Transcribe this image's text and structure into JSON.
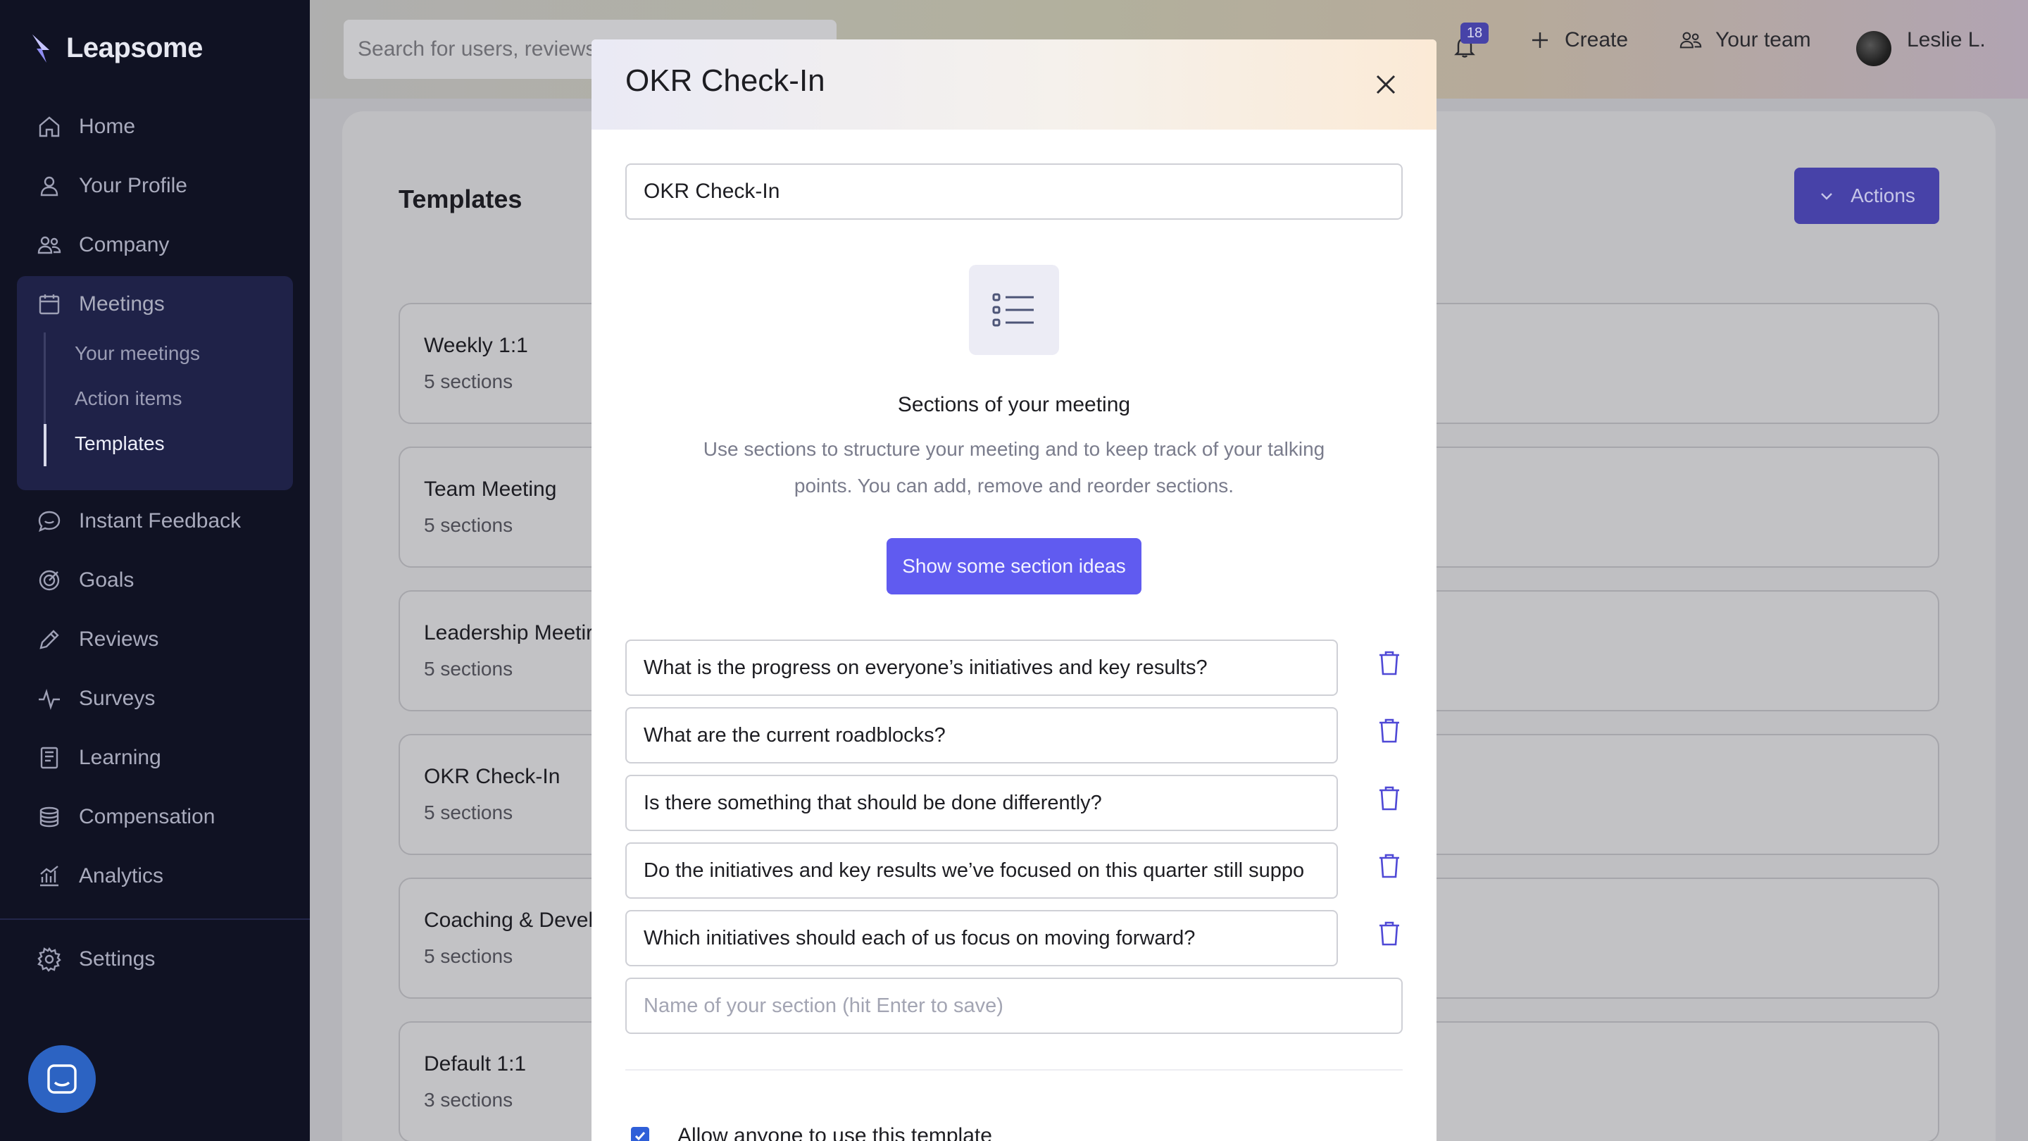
{
  "brand": {
    "name": "Leapsome"
  },
  "sidebar": {
    "items": [
      {
        "label": "Home",
        "icon": "home-icon"
      },
      {
        "label": "Your Profile",
        "icon": "user-icon"
      },
      {
        "label": "Company",
        "icon": "users-icon"
      },
      {
        "label": "Meetings",
        "icon": "calendar-icon"
      },
      {
        "label": "Instant Feedback",
        "icon": "chat-icon"
      },
      {
        "label": "Goals",
        "icon": "target-icon"
      },
      {
        "label": "Reviews",
        "icon": "pencil-icon"
      },
      {
        "label": "Surveys",
        "icon": "pulse-icon"
      },
      {
        "label": "Learning",
        "icon": "book-icon"
      },
      {
        "label": "Compensation",
        "icon": "coins-icon"
      },
      {
        "label": "Analytics",
        "icon": "chart-icon"
      },
      {
        "label": "Settings",
        "icon": "gear-icon"
      }
    ],
    "meetings_sub": [
      {
        "label": "Your meetings"
      },
      {
        "label": "Action items"
      },
      {
        "label": "Templates",
        "active": true
      }
    ]
  },
  "header": {
    "search_placeholder": "Search for users, reviews",
    "notification_count": "18",
    "create_label": "Create",
    "team_label": "Your team",
    "user_name": "Leslie L."
  },
  "main": {
    "title": "Templates",
    "actions_label": "Actions",
    "templates": [
      {
        "name": "Weekly 1:1",
        "sections": "5 sections"
      },
      {
        "name": "Team Meeting",
        "sections": "5 sections"
      },
      {
        "name": "Leadership Meetir",
        "sections": "5 sections"
      },
      {
        "name": "OKR Check-In",
        "sections": "5 sections"
      },
      {
        "name": "Coaching & Devel",
        "sections": "5 sections"
      },
      {
        "name": "Default 1:1",
        "sections": "3 sections"
      }
    ]
  },
  "modal": {
    "title": "OKR Check-In",
    "name_value": "OKR Check-In",
    "sections_title": "Sections of your meeting",
    "sections_description": "Use sections to structure your meeting and to keep track of your talking points. You can add, remove and reorder sections.",
    "ideas_button": "Show some section ideas",
    "sections": [
      "What is the progress on everyone’s initiatives and key results?",
      "What are the current roadblocks?",
      "Is there something that should be done differently?",
      "Do the initiatives and key results we’ve focused on this quarter still suppo",
      "Which initiatives should each of us focus on moving forward?"
    ],
    "new_section_placeholder": "Name of your section (hit Enter to save)",
    "allow_label": "Allow anyone to use this template",
    "allow_checked": true
  },
  "colors": {
    "sidebar_bg": "#101223",
    "accent": "#605bf0",
    "actions_bg": "#4742a8"
  }
}
